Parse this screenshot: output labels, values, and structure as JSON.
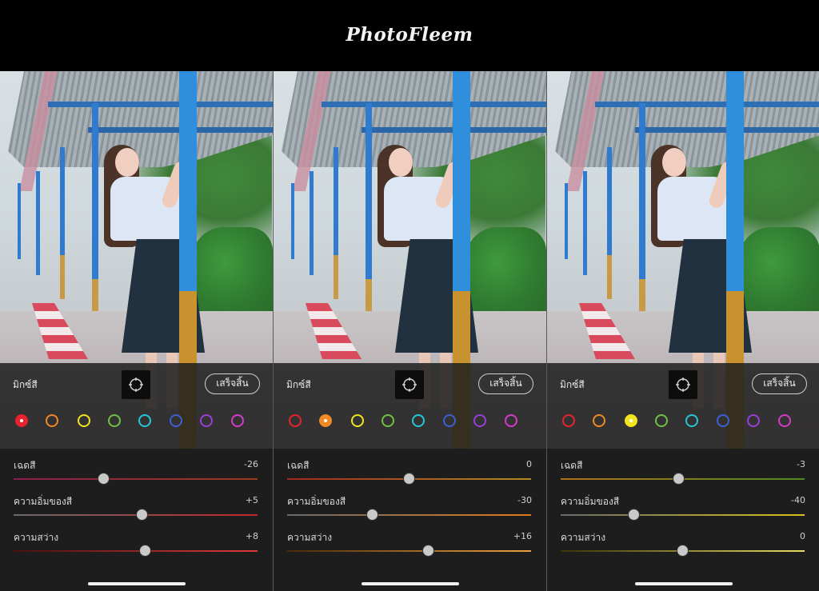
{
  "header": {
    "logo_text": "PhotoFleem"
  },
  "panels": [
    {
      "mix_label": "มิกซ์สี",
      "done_label": "เสร็จสิ้น",
      "selected_color": "red",
      "sliders": [
        {
          "label": "เฉดสี",
          "value_text": "-26",
          "value": -26
        },
        {
          "label": "ความอิ่มของสี",
          "value_text": "+5",
          "value": 5
        },
        {
          "label": "ความสว่าง",
          "value_text": "+8",
          "value": 8
        }
      ]
    },
    {
      "mix_label": "มิกซ์สี",
      "done_label": "เสร็จสิ้น",
      "selected_color": "orange",
      "sliders": [
        {
          "label": "เฉดสี",
          "value_text": "0",
          "value": 0
        },
        {
          "label": "ความอิ่มของสี",
          "value_text": "-30",
          "value": -30
        },
        {
          "label": "ความสว่าง",
          "value_text": "+16",
          "value": 16
        }
      ]
    },
    {
      "mix_label": "มิกซ์สี",
      "done_label": "เสร็จสิ้น",
      "selected_color": "yellow",
      "sliders": [
        {
          "label": "เฉดสี",
          "value_text": "-3",
          "value": -3
        },
        {
          "label": "ความอิ่มของสี",
          "value_text": "-40",
          "value": -40
        },
        {
          "label": "ความสว่าง",
          "value_text": "0",
          "value": 0
        }
      ]
    }
  ],
  "color_swatches": [
    {
      "name": "red",
      "hex": "#e8232f"
    },
    {
      "name": "orange",
      "hex": "#f08a24"
    },
    {
      "name": "yellow",
      "hex": "#f2e51e"
    },
    {
      "name": "green",
      "hex": "#6fc046"
    },
    {
      "name": "aqua",
      "hex": "#24c6d6"
    },
    {
      "name": "blue",
      "hex": "#3d5fd0"
    },
    {
      "name": "purple",
      "hex": "#9a3fd6"
    },
    {
      "name": "magenta",
      "hex": "#d23cc8"
    }
  ],
  "slider_colors": {
    "red": {
      "hue": [
        "#8b1f4f",
        "#9a3a1f"
      ],
      "sat": [
        "#6a6a6a",
        "#c4262b"
      ],
      "lum": [
        "#4a1010",
        "#e03a3a"
      ]
    },
    "orange": {
      "hue": [
        "#a1281f",
        "#b08a20"
      ],
      "sat": [
        "#6a6a6a",
        "#e07a1a"
      ],
      "lum": [
        "#4a2a08",
        "#f0a040"
      ]
    },
    "yellow": {
      "hue": [
        "#b0701a",
        "#4f8a1f"
      ],
      "sat": [
        "#6a6a6a",
        "#d6c21a"
      ],
      "lum": [
        "#3a3408",
        "#e8dc60"
      ]
    }
  }
}
